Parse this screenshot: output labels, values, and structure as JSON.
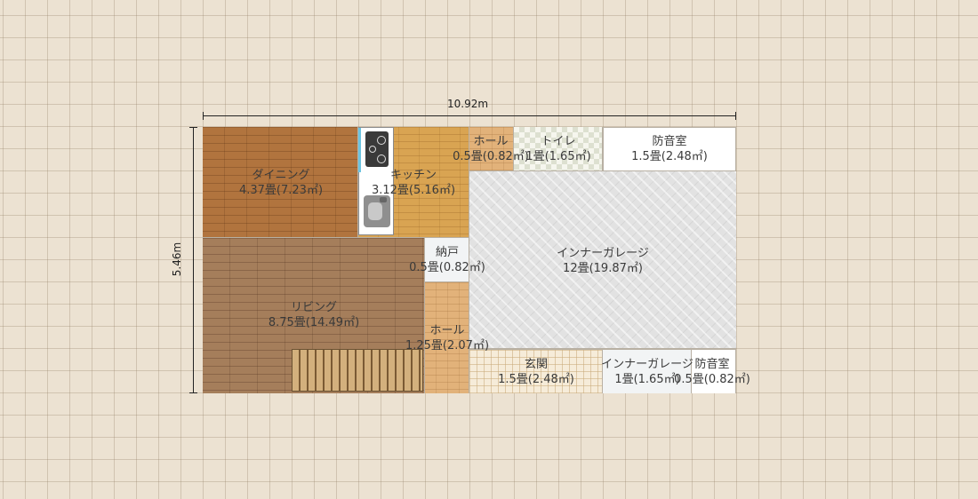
{
  "dimensions": {
    "width_label": "10.92m",
    "height_label": "5.46m"
  },
  "rooms": {
    "dining": {
      "name": "ダイニング",
      "area": "4.37畳(7.23㎡)"
    },
    "kitchen": {
      "name": "キッチン",
      "area": "3.12畳(5.16㎡)"
    },
    "hall_top": {
      "name": "ホール",
      "area": "0.5畳(0.82㎡)"
    },
    "toilet": {
      "name": "トイレ",
      "area": "1畳(1.65㎡)"
    },
    "soundproof_top": {
      "name": "防音室",
      "area": "1.5畳(2.48㎡)"
    },
    "storage": {
      "name": "納戸",
      "area": "0.5畳(0.82㎡)"
    },
    "garage_main": {
      "name": "インナーガレージ",
      "area": "12畳(19.87㎡)"
    },
    "living": {
      "name": "リビング",
      "area": "8.75畳(14.49㎡)"
    },
    "hall_mid": {
      "name": "ホール",
      "area": "1.25畳(2.07㎡)"
    },
    "entrance": {
      "name": "玄関",
      "area": "1.5畳(2.48㎡)"
    },
    "garage_small": {
      "name": "インナーガレージ",
      "area": "1畳(1.65㎡)"
    },
    "soundproof_bot": {
      "name": "防音室",
      "area": "0.5畳(0.82㎡)"
    }
  },
  "fixtures": {
    "stove": "stove-icon",
    "sink": "sink-icon",
    "stairs": "staircase-icon"
  }
}
